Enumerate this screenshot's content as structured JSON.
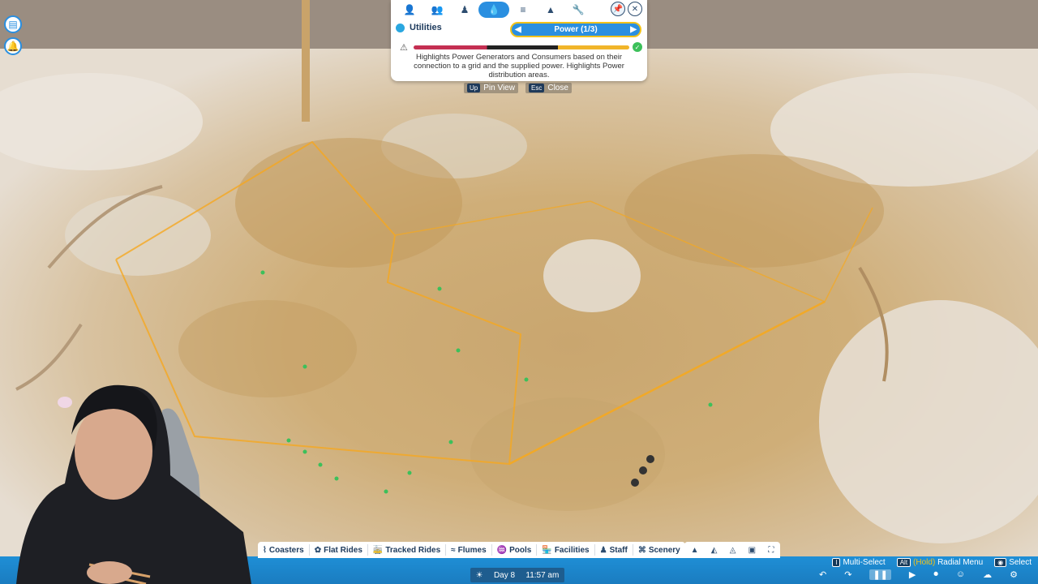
{
  "colors": {
    "accent": "#2a8fe0",
    "power_line": "#f5a820",
    "highlight_yellow": "#f2c21a",
    "consumer_green": "#3cc05a"
  },
  "left_icons": [
    {
      "name": "clipboard-icon"
    },
    {
      "name": "bell-icon"
    }
  ],
  "overlay_panel": {
    "tabs": [
      {
        "icon": "guests-management-icon",
        "glyph": "👤"
      },
      {
        "icon": "groups-icon",
        "glyph": "👥"
      },
      {
        "icon": "staff-icon",
        "glyph": "♟"
      },
      {
        "icon": "utilities-icon",
        "glyph": "💧",
        "active": true
      },
      {
        "icon": "finance-icon",
        "glyph": "≡"
      },
      {
        "icon": "scenery-icon",
        "glyph": "▲"
      },
      {
        "icon": "wrench-icon",
        "glyph": "🔧"
      }
    ],
    "pin_glyph": "📌",
    "close_glyph": "✕",
    "section_label": "Utilities",
    "view_selector": {
      "value": "Power (1/3)",
      "prev_glyph": "◀",
      "next_glyph": "▶"
    },
    "warning_glyph": "⚠",
    "check_glyph": "✓",
    "description": "Highlights Power Generators and Consumers based on their connection to a grid and the supplied power. Highlights Power distribution areas."
  },
  "hints": {
    "pin": {
      "key": "Up",
      "label": "Pin View"
    },
    "close": {
      "key": "Esc",
      "label": "Close"
    }
  },
  "categories": [
    {
      "icon": "coaster-icon",
      "glyph": "⌇",
      "label": "Coasters"
    },
    {
      "icon": "flat-rides-icon",
      "glyph": "✿",
      "label": "Flat Rides"
    },
    {
      "icon": "tracked-rides-icon",
      "glyph": "🚋",
      "label": "Tracked Rides"
    },
    {
      "icon": "flumes-icon",
      "glyph": "≈",
      "label": "Flumes"
    },
    {
      "icon": "pools-icon",
      "glyph": "♒",
      "label": "Pools"
    },
    {
      "icon": "facilities-icon",
      "glyph": "🏪",
      "label": "Facilities"
    },
    {
      "icon": "staff-icon",
      "glyph": "♟",
      "label": "Staff"
    },
    {
      "icon": "scenery-icon",
      "glyph": "⌘",
      "label": "Scenery"
    }
  ],
  "tools": [
    {
      "icon": "terrain-icon",
      "glyph": "▲"
    },
    {
      "icon": "paint-terrain-icon",
      "glyph": "◭"
    },
    {
      "icon": "water-icon",
      "glyph": "◬"
    },
    {
      "icon": "blueprint-icon",
      "glyph": "▣"
    },
    {
      "icon": "fullscreen-icon",
      "glyph": "⛶"
    }
  ],
  "controls": {
    "multi_select": {
      "key": "I",
      "label": "Multi-Select"
    },
    "radial": {
      "key": "Alt",
      "hold": "(Hold)",
      "label": "Radial Menu"
    },
    "select": {
      "key": "◉",
      "label": "Select"
    }
  },
  "clock": {
    "sun_glyph": "☀",
    "day": "Day 8",
    "time": "11:57 am"
  },
  "speed": [
    {
      "icon": "undo-icon",
      "glyph": "↶"
    },
    {
      "icon": "redo-icon",
      "glyph": "↷"
    },
    {
      "icon": "pause-icon",
      "glyph": "❚❚",
      "active": true
    },
    {
      "icon": "play-icon",
      "glyph": "▶"
    },
    {
      "icon": "camera-icon",
      "glyph": "⏺"
    },
    {
      "icon": "guest-icon",
      "glyph": "☺"
    },
    {
      "icon": "weather-icon",
      "glyph": "☁"
    },
    {
      "icon": "settings-icon",
      "glyph": "⚙"
    }
  ]
}
